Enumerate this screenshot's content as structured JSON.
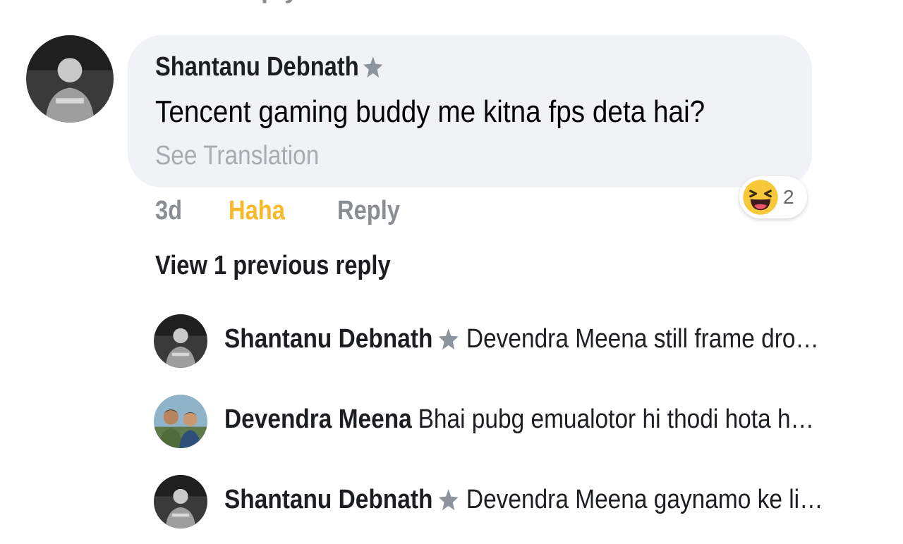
{
  "partial_top_text": "ply",
  "comment": {
    "author": "Shantanu Debnath",
    "text": "Tencent gaming buddy me kitna fps deta hai?",
    "see_translation": "See Translation",
    "reaction_icon": "haha-emoji-icon",
    "reaction_count": "2",
    "time": "3d",
    "reaction_label": "Haha",
    "reply_label": "Reply",
    "reaction_color": "#f7b928"
  },
  "replies_section": {
    "view_previous": "View 1 previous reply",
    "items": [
      {
        "author": "Shantanu Debnath",
        "has_badge": true,
        "text": "Devendra Meena still frame dro…"
      },
      {
        "author": "Devendra Meena",
        "has_badge": false,
        "text": "Bhai pubg emualotor hi thodi hota h…"
      },
      {
        "author": "Shantanu Debnath",
        "has_badge": true,
        "text": "Devendra Meena gaynamo ke li…"
      }
    ]
  },
  "colors": {
    "bubble_bg": "#f0f2f5",
    "muted_text": "#8a8d91",
    "primary_text": "#1c1e21",
    "haha_yellow": "#f7b928"
  }
}
